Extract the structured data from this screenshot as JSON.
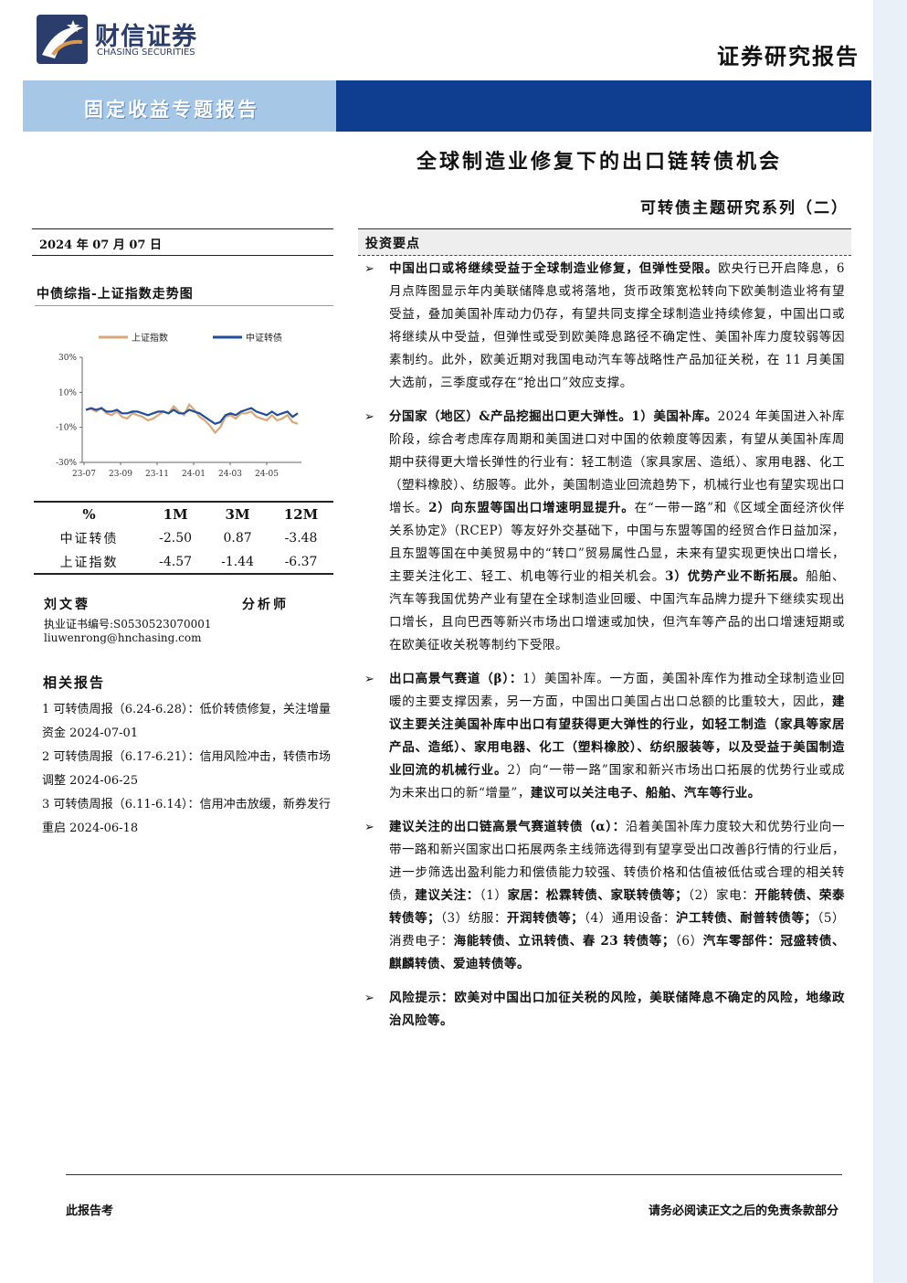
{
  "header": {
    "logo_cn": "财信证券",
    "logo_en": "CHASING SECURITIES",
    "report_type": "证券研究报告",
    "banner": "固定收益专题报告",
    "title": "全球制造业修复下的出口链转债机会",
    "series": "可转债主题研究系列（二）",
    "colors": {
      "banner_dark": "#0f3e91",
      "banner_light": "#a7c7e7"
    }
  },
  "left": {
    "date": "2024 年 07 月 07 日",
    "chart_title": "中债综指-上证指数走势图",
    "table": {
      "headers": [
        "%",
        "1M",
        "3M",
        "12M"
      ],
      "rows": [
        [
          "中证转债",
          "-2.50",
          "0.87",
          "-3.48"
        ],
        [
          "上证指数",
          "-4.57",
          "-1.44",
          "-6.37"
        ]
      ]
    },
    "author": {
      "name": "刘文蓉",
      "role": "分析师",
      "license": "执业证书编号:S0530523070001",
      "email": "liuwenrong@hnchasing.com"
    },
    "related_title": "相关报告",
    "related": [
      "1 可转债周报（6.24-6.28）：低价转债修复，关注增量资金 2024-07-01",
      "2 可转债周报（6.17-6.21）：信用风险冲击，转债市场调整 2024-06-25",
      "3 可转债周报（6.11-6.14）：信用冲击放缓，新券发行重启 2024-06-18"
    ]
  },
  "chart_data": {
    "type": "line",
    "title": "中债综指-上证指数走势图",
    "x_ticks": [
      "23-07",
      "23-09",
      "23-11",
      "24-01",
      "24-03",
      "24-05"
    ],
    "y_ticks": [
      "30%",
      "10%",
      "-10%",
      "-30%"
    ],
    "ylim": [
      -30,
      30
    ],
    "legend_position": "top",
    "series": [
      {
        "name": "上证指数",
        "color": "#d9a77a",
        "values": [
          0,
          0.5,
          -1,
          1,
          -2,
          -3,
          -1,
          -4,
          -5,
          -2,
          -3,
          -4,
          -6,
          -5,
          -3,
          -1,
          -2,
          2,
          -1,
          -3,
          3,
          0,
          -4,
          -6,
          -9,
          -13,
          -10,
          -4,
          -3,
          -5,
          -2,
          -2,
          -1,
          -4,
          -5,
          -6,
          -3,
          -6,
          -5,
          -3,
          -7,
          -8
        ]
      },
      {
        "name": "中证转债",
        "color": "#1f4e9c",
        "values": [
          0,
          1,
          0,
          1,
          -1,
          -1,
          0,
          -2,
          -2,
          -1,
          -1,
          -2,
          -3,
          -2,
          -1,
          -1,
          -2,
          0,
          -2,
          -2,
          0,
          -1,
          -2,
          -4,
          -6,
          -8,
          -7,
          -3,
          -2,
          -3,
          -1,
          0,
          1,
          -1,
          -2,
          -3,
          -1,
          -3,
          -2,
          -1,
          -4,
          -2
        ]
      }
    ]
  },
  "right": {
    "header": "投资要点",
    "items": [
      [
        {
          "b": true,
          "t": "中国出口或将继续受益于全球制造业修复，但弹性受限。"
        },
        {
          "b": false,
          "t": "欧央行已开启降息，6 月点阵图显示年内美联储降息或将落地，货币政策宽松转向下欧美制造业将有望受益，叠加美国补库动力仍存，有望共同支撑全球制造业持续修复，中国出口或将继续从中受益，但弹性或受到欧美降息路径不确定性、美国补库力度较弱等因素制约。此外，欧美近期对我国电动汽车等战略性产品加征关税，在 11 月美国大选前，三季度或存在“抢出口”效应支撑。"
        }
      ],
      [
        {
          "b": true,
          "t": "分国家（地区）&产品挖掘出口更大弹性。1）美国补库。"
        },
        {
          "b": false,
          "t": "2024 年美国进入补库阶段，综合考虑库存周期和美国进口对中国的依赖度等因素，有望从美国补库周期中获得更大增长弹性的行业有：轻工制造（家具家居、造纸）、家用电器、化工（塑料橡胶）、纺服等。此外，美国制造业回流趋势下，机械行业也有望实现出口增长。"
        },
        {
          "b": true,
          "t": "2）向东盟等国出口增速明显提升。"
        },
        {
          "b": false,
          "t": "在“一带一路”和《区域全面经济伙伴关系协定》（RCEP）等友好外交基础下，中国与东盟等国的经贸合作日益加深，且东盟等国在中美贸易中的“转口”贸易属性凸显，未来有望实现更快出口增长，主要关注化工、轻工、机电等行业的相关机会。"
        },
        {
          "b": true,
          "t": "3）优势产业不断拓展。"
        },
        {
          "b": false,
          "t": "船舶、汽车等我国优势产业有望在全球制造业回暖、中国汽车品牌力提升下继续实现出口增长，且向巴西等新兴市场出口增速或加快，但汽车等产品的出口增速短期或在欧美征收关税等制约下受限。"
        }
      ],
      [
        {
          "b": true,
          "t": "出口高景气赛道（β）："
        },
        {
          "b": false,
          "t": "1）美国补库。一方面，美国补库作为推动全球制造业回暖的主要支撑因素，另一方面，中国出口美国占出口总额的比重较大，因此，"
        },
        {
          "b": true,
          "t": "建议主要关注美国补库中出口有望获得更大弹性的行业，如轻工制造（家具等家居产品、造纸）、家用电器、化工（塑料橡胶）、纺织服装等，以及受益于美国制造业回流的机械行业。"
        },
        {
          "b": false,
          "t": "2）向“一带一路”国家和新兴市场出口拓展的优势行业或成为未来出口的新“增量”，"
        },
        {
          "b": true,
          "t": "建议可以关注电子、船舶、汽车等行业。"
        }
      ],
      [
        {
          "b": true,
          "t": "建议关注的出口链高景气赛道转债（α）："
        },
        {
          "b": false,
          "t": "沿着美国补库力度较大和优势行业向一带一路和新兴国家出口拓展两条主线筛选得到有望享受出口改善β行情的行业后，进一步筛选出盈利能力和偿债能力较强、转债价格和估值被低估或合理的相关转债，"
        },
        {
          "b": true,
          "t": "建议关注："
        },
        {
          "b": false,
          "t": "（1）"
        },
        {
          "b": true,
          "t": "家居：松霖转债、家联转债等；"
        },
        {
          "b": false,
          "t": "（2）家电："
        },
        {
          "b": true,
          "t": "开能转债、荣泰转债等；"
        },
        {
          "b": false,
          "t": "（3）纺服："
        },
        {
          "b": true,
          "t": "开润转债等；"
        },
        {
          "b": false,
          "t": "（4）通用设备："
        },
        {
          "b": true,
          "t": "沪工转债、耐普转债等；"
        },
        {
          "b": false,
          "t": "（5）消费电子："
        },
        {
          "b": true,
          "t": "海能转债、立讯转债、春 23 转债等；"
        },
        {
          "b": false,
          "t": "（6）"
        },
        {
          "b": true,
          "t": "汽车零部件：冠盛转债、麒麟转债、爱迪转债等。"
        }
      ],
      [
        {
          "b": true,
          "t": "风险提示：欧美对中国出口加征关税的风险，美联储降息不确定的风险，地缘政治风险等。"
        }
      ]
    ]
  },
  "footer": {
    "left": "此报告考",
    "right": "请务必阅读正文之后的免责条款部分"
  }
}
